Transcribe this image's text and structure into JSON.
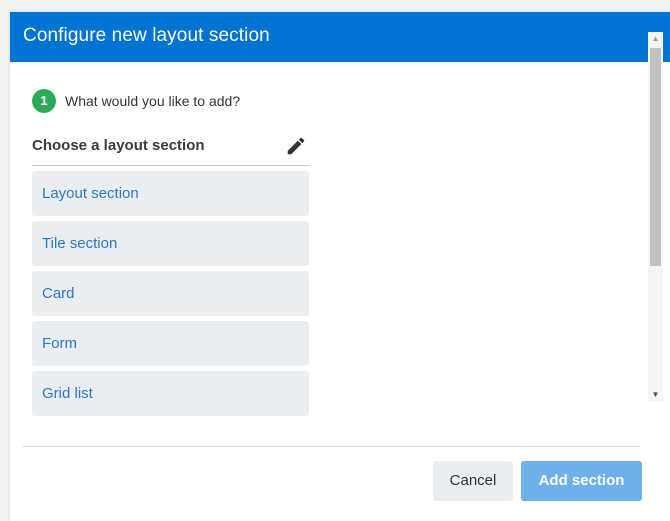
{
  "dialog": {
    "title": "Configure new layout section"
  },
  "step": {
    "number": "1",
    "label": "What would you like to add?"
  },
  "chooser": {
    "title": "Choose a layout section",
    "edit_icon": "pencil-icon",
    "options": [
      {
        "label": "Layout section"
      },
      {
        "label": "Tile section"
      },
      {
        "label": "Card"
      },
      {
        "label": "Form"
      },
      {
        "label": "Grid list"
      }
    ]
  },
  "footer": {
    "cancel_label": "Cancel",
    "add_label": "Add section"
  },
  "colors": {
    "header_bg": "#0074d3",
    "step_badge": "#2eaa5a",
    "option_text": "#2a79c8",
    "option_bg": "#ebeef1",
    "primary_button": "#6eb1ea"
  }
}
